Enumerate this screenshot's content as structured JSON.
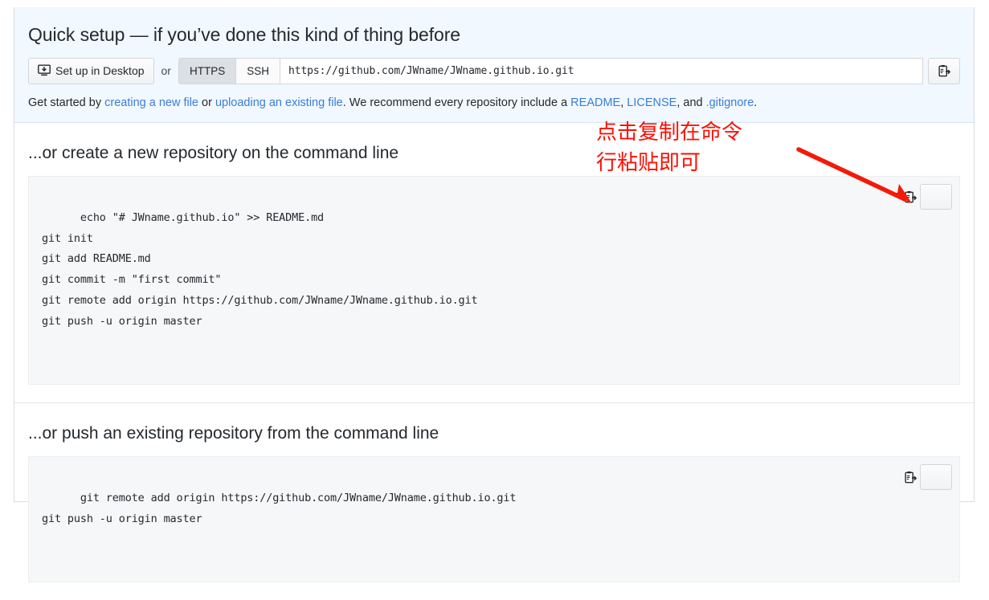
{
  "quick_setup": {
    "title": "Quick setup — if you’ve done this kind of thing before",
    "desktop_button_label": "Set up in Desktop",
    "desktop_icon": "desktop-download-icon",
    "or_label": "or",
    "protocols": [
      {
        "label": "HTTPS",
        "selected": true
      },
      {
        "label": "SSH",
        "selected": false
      }
    ],
    "clone_url": "https://github.com/JWname/JWname.github.io.git",
    "copy_icon": "clipboard-copy-icon",
    "get_started": {
      "prefix": "Get started by ",
      "link_create": "creating a new file",
      "mid_or": " or ",
      "link_upload": "uploading an existing file",
      "recommend": ". We recommend every repository include a ",
      "link_readme": "README",
      "sep1": ", ",
      "link_license": "LICENSE",
      "sep2": ", and ",
      "link_gitignore": ".gitignore",
      "suffix": "."
    }
  },
  "create_section": {
    "title": "...or create a new repository on the command line",
    "commands": "echo \"# JWname.github.io\" >> README.md\ngit init\ngit add README.md\ngit commit -m \"first commit\"\ngit remote add origin https://github.com/JWname/JWname.github.io.git\ngit push -u origin master",
    "copy_icon": "clipboard-copy-icon"
  },
  "push_section": {
    "title": "...or push an existing repository from the command line",
    "commands": "git remote add origin https://github.com/JWname/JWname.github.io.git\ngit push -u origin master",
    "copy_icon": "clipboard-copy-icon"
  },
  "annotation": {
    "line1": "点击复制在命令",
    "line2": "行粘贴即可",
    "color": "#fb1105",
    "arrow": "red-arrow-pointing-to-copy-button"
  }
}
